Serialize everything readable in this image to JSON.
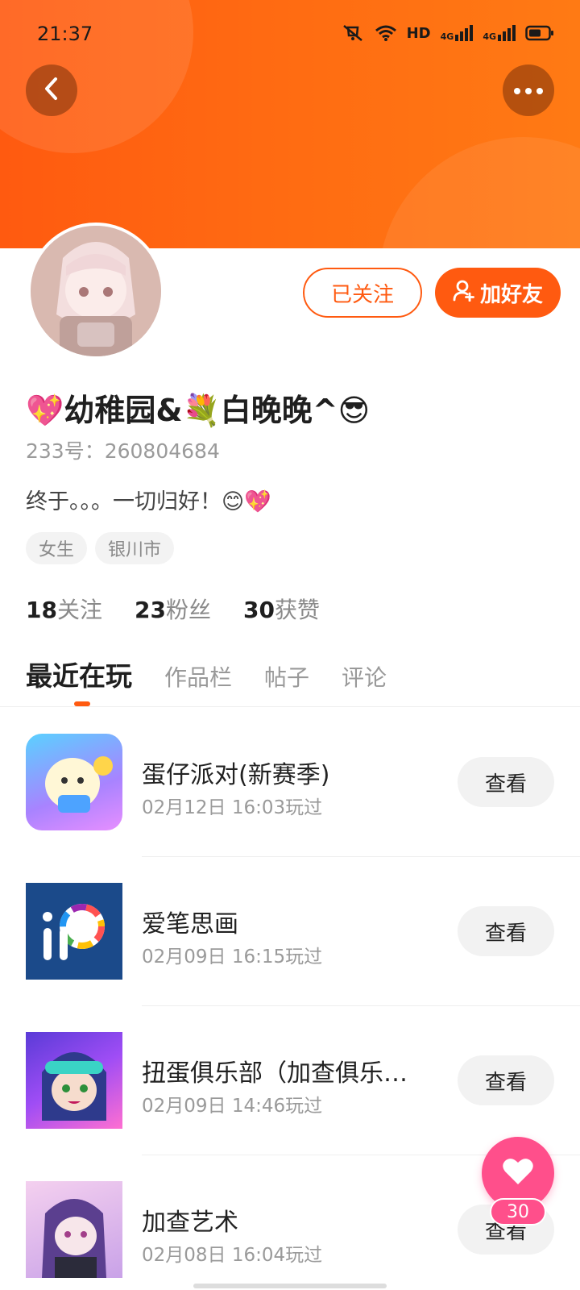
{
  "status_bar": {
    "time": "21:37",
    "network1": "4G",
    "network2": "4G",
    "hd_label": "HD"
  },
  "header": {
    "accent_color": "#ff5a10"
  },
  "profile": {
    "followed_label": "已关注",
    "add_friend_label": "加好友",
    "nickname": "💖幼稚园&💐白晚晚^😎",
    "uid": "233号：260804684",
    "bio": "终于。。。一切归好！😊💖",
    "tags": [
      "女生",
      "银川市"
    ],
    "stats": [
      {
        "num": "18",
        "label": "关注"
      },
      {
        "num": "23",
        "label": "粉丝"
      },
      {
        "num": "30",
        "label": "获赞"
      }
    ]
  },
  "tabs": [
    "最近在玩",
    "作品栏",
    "帖子",
    "评论"
  ],
  "games": [
    {
      "title": "蛋仔派对(新赛季)",
      "time": "02月12日 16:03玩过",
      "action": "查看"
    },
    {
      "title": "爱笔思画",
      "time": "02月09日 16:15玩过",
      "action": "查看"
    },
    {
      "title": "扭蛋俱乐部（加查俱乐部）",
      "time": "02月09日 14:46玩过",
      "action": "查看"
    },
    {
      "title": "加查艺术",
      "time": "02月08日 16:04玩过",
      "action": "查看"
    }
  ],
  "fab": {
    "count": "30"
  }
}
